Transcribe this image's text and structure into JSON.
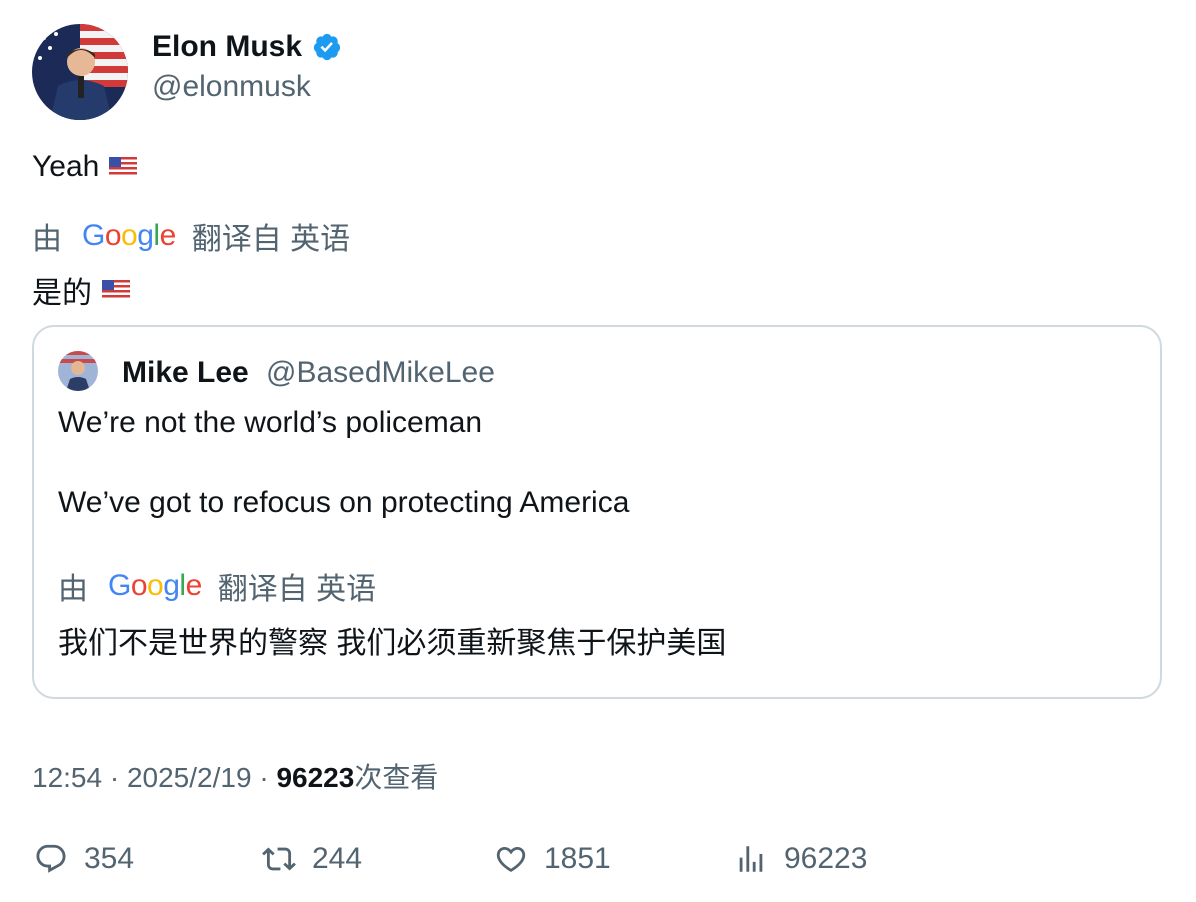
{
  "author": {
    "name": "Elon Musk",
    "handle": "@elonmusk",
    "verified": true,
    "avatar_icon": "avatar-elon-musk"
  },
  "tweet": {
    "text": "Yeah",
    "translation_by": "由",
    "google_brand": "Google",
    "translated_from": "翻译自 英语",
    "translation": "是的"
  },
  "quote": {
    "name": "Mike Lee",
    "handle": "@BasedMikeLee",
    "line1": "We’re not the world’s policeman",
    "line2": "We’ve got to refocus on protecting America",
    "translation_by": "由",
    "google_brand": "Google",
    "translated_from": "翻译自 英语",
    "translation": "我们不是世界的警察 我们必须重新聚焦于保护美国"
  },
  "meta": {
    "time": "12:54",
    "sep": " · ",
    "date": "2025/2/19",
    "views_count": "96223",
    "views_label": "次查看"
  },
  "actions": {
    "replies": "354",
    "retweets": "244",
    "likes": "1851",
    "views": "96223"
  },
  "colors": {
    "text": "#0f1419",
    "secondary": "#536471",
    "verified": "#1d9bf0",
    "border": "#cfd9de"
  }
}
